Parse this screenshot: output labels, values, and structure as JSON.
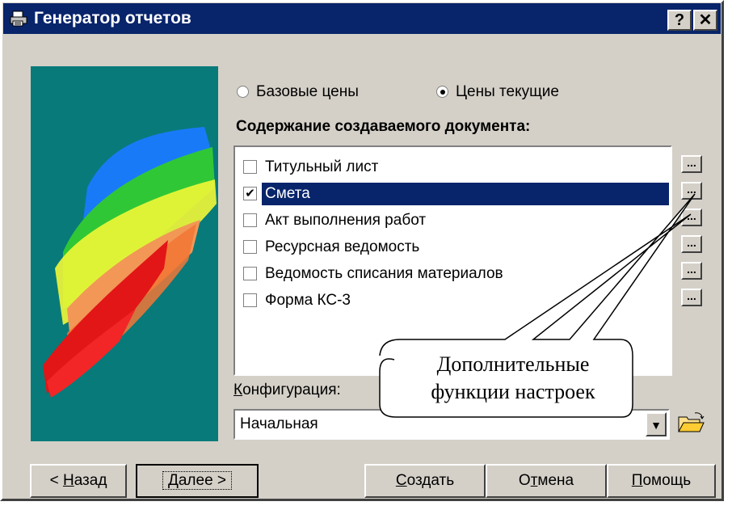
{
  "window": {
    "title": "Генератор отчетов",
    "help_btn": "?",
    "close_btn": "✕"
  },
  "price_mode": {
    "options": [
      {
        "label": "Базовые цены",
        "selected": false
      },
      {
        "label": "Цены текущие",
        "selected": true
      }
    ]
  },
  "content": {
    "heading": "Содержание создаваемого документа:",
    "items": [
      {
        "label": "Титульный лист",
        "checked": false,
        "check": ""
      },
      {
        "label": "Смета",
        "checked": true,
        "check": "✔"
      },
      {
        "label": "Акт выполнения работ",
        "checked": false,
        "check": ""
      },
      {
        "label": "Ресурсная ведомость",
        "checked": false,
        "check": ""
      },
      {
        "label": "Ведомость списания материалов",
        "checked": false,
        "check": ""
      },
      {
        "label": "Форма КС-3",
        "checked": false,
        "check": ""
      }
    ],
    "more_button_label": "..."
  },
  "config": {
    "label_underlined": "К",
    "label_rest": "онфигурация:",
    "value": "Начальная",
    "dropdown_icon": "▼"
  },
  "buttons": {
    "back": {
      "prefix": "< ",
      "u": "Н",
      "rest": "азад"
    },
    "next": {
      "u": "Д",
      "rest": "алее >"
    },
    "create": {
      "u": "С",
      "rest": "оздать"
    },
    "cancel": {
      "pre": "О",
      "u": "т",
      "rest": "мена"
    },
    "help": {
      "u": "П",
      "rest": "омощь"
    }
  },
  "callout": {
    "line1": "Дополнительные",
    "line2": "функции настроек"
  },
  "colors": {
    "title_bg": "#08246b",
    "picture_bg": "#087a7a",
    "face": "#d4d0c8"
  }
}
